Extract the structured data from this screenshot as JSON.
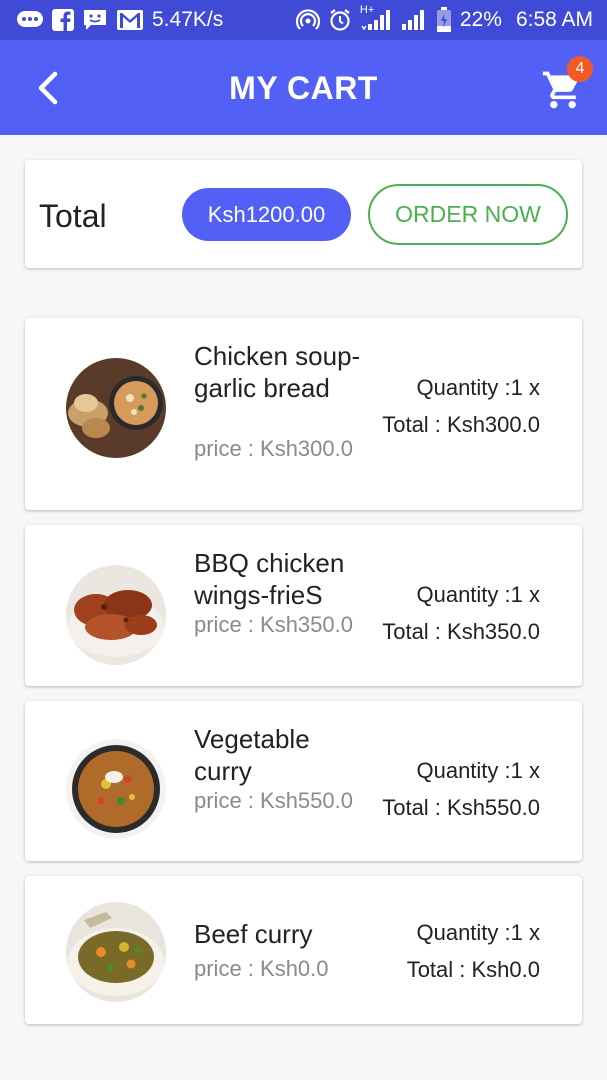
{
  "status_bar": {
    "network_speed": "5.47K/s",
    "network_type": "H+",
    "battery": "22%",
    "time": "6:58 AM",
    "icons": [
      "chat-icon",
      "facebook-icon",
      "message-icon",
      "gmail-icon",
      "hotspot-icon",
      "alarm-icon",
      "signal-icon",
      "signal-icon",
      "battery-icon"
    ]
  },
  "app_bar": {
    "title": "MY CART",
    "cart_count": "4",
    "colors": {
      "bar": "#5360f6",
      "badge": "#f15a24"
    }
  },
  "summary": {
    "label": "Total",
    "amount": "Ksh1200.00",
    "order_button": "ORDER NOW",
    "colors": {
      "pill": "#5360f6",
      "order": "#4caf50"
    }
  },
  "items": [
    {
      "name": "Chicken soup-garlic bread",
      "price": "price : Ksh300.0",
      "quantity": "Quantity :1 x",
      "total": "Total : Ksh300.0"
    },
    {
      "name": "BBQ chicken wings-frieS",
      "price": "price : Ksh350.0",
      "quantity": "Quantity :1 x",
      "total": "Total : Ksh350.0"
    },
    {
      "name": "Vegetable curry",
      "price": "price : Ksh550.0",
      "quantity": "Quantity :1 x",
      "total": "Total : Ksh550.0"
    },
    {
      "name": "Beef curry",
      "price": "price : Ksh0.0",
      "quantity": "Quantity :1 x",
      "total": "Total : Ksh0.0"
    }
  ]
}
